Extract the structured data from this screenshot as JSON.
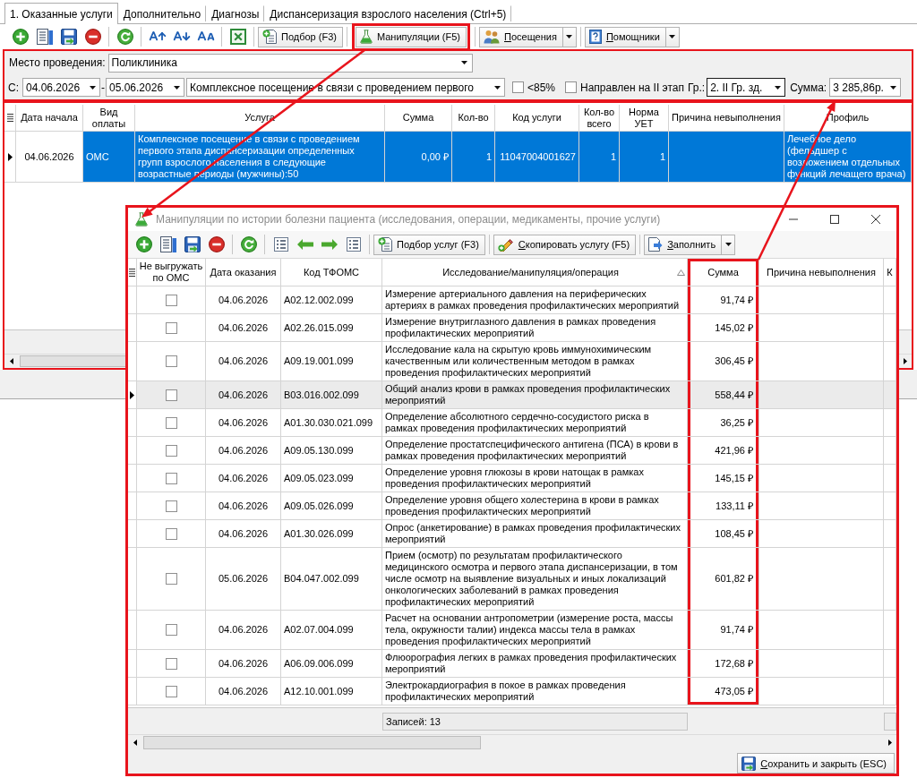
{
  "tabs": [
    {
      "label": "1. Оказанные услуги",
      "selected": true
    },
    {
      "label": "Дополнительно",
      "selected": false
    },
    {
      "label": "Диагнозы",
      "selected": false
    },
    {
      "label": "Диспансеризация взрослого населения (Ctrl+5)",
      "selected": false
    }
  ],
  "toolbar": {
    "buttons": [
      {
        "label": "Подбор (F3)",
        "kind": "button",
        "mnemonic": false,
        "highlighted": false
      },
      {
        "label": "Манипуляции (F5)",
        "kind": "button",
        "mnemonic": false,
        "highlighted": true
      },
      {
        "label": "Посещения",
        "kind": "split",
        "mnemonic": true,
        "highlighted": false
      },
      {
        "label": "Помощники",
        "kind": "split",
        "mnemonic": true,
        "highlighted": false
      }
    ]
  },
  "filters": {
    "highlighted": true,
    "place": {
      "label": "Место проведения:",
      "value": "Поликлиника"
    },
    "period": {
      "label": "С:",
      "from": "04.06.2026",
      "separator": "-",
      "to": "05.06.2026"
    },
    "visit_type": {
      "value": "Комплексное посещение в связи с проведением первого"
    },
    "checkboxes": [
      {
        "label": "<85%",
        "checked": false
      },
      {
        "label": "Направлен на II этап",
        "checked": false
      }
    ],
    "group": {
      "label": "Гр.:",
      "value": "2. II Гр. зд.",
      "focused": true
    },
    "sum": {
      "label": "Сумма:",
      "value": "3 285,86р."
    }
  },
  "services_table": {
    "highlighted": true,
    "columns": [
      "Дата начала",
      "Вид оплаты",
      "Услуга",
      "Сумма",
      "Кол-во",
      "Код услуги",
      "Кол-во всего",
      "Норма УЕТ",
      "Причина невыполнения",
      "Профиль"
    ],
    "rows": [
      {
        "selected": true,
        "cells": [
          {
            "text": "04.06.2026",
            "focused": true
          },
          {
            "text": "ОМС",
            "focused": false
          },
          {
            "text": "Комплексное посещение в связи с проведением первого этапа диспансеризации определенных групп взрослого населения в следующие возрастные периоды (мужчины):50",
            "focused": false
          },
          {
            "text": "0,00 ₽",
            "focused": false
          },
          {
            "text": "1",
            "focused": false
          },
          {
            "text": "11047004001627",
            "focused": false
          },
          {
            "text": "1",
            "focused": false
          },
          {
            "text": "1",
            "focused": false
          },
          {
            "focused": false
          },
          {
            "text": "Лечебное дело (фельдшер с возложением отдельных функций лечащего врача)",
            "focused": false
          }
        ]
      }
    ]
  },
  "dialog": {
    "title": "Манипуляции по истории болезни пациента (исследования, операции, медикаменты, прочие услуги)",
    "active": false,
    "highlighted": true,
    "toolbar": {
      "buttons": [
        {
          "label": "Подбор услуг (F3)",
          "kind": "button",
          "mnemonic": false
        },
        {
          "label": "Скопировать услугу (F5)",
          "kind": "button",
          "mnemonic": true
        },
        {
          "label": "Заполнить",
          "kind": "split",
          "mnemonic": true
        }
      ]
    },
    "table": {
      "columns": [
        {
          "label": "Не выгружать по ОМС",
          "sorted": false,
          "highlighted": false
        },
        {
          "label": "Дата оказания",
          "sorted": false,
          "highlighted": false
        },
        {
          "label": "Код ТФОМС",
          "sorted": false,
          "highlighted": false
        },
        {
          "label": "Исследование/манипуляция/операция",
          "sorted": true,
          "highlighted": false
        },
        {
          "label": "Сумма",
          "sorted": false,
          "highlighted": true
        },
        {
          "label": "Причина невыполнения",
          "sorted": false,
          "highlighted": false
        },
        {
          "label": "К",
          "sorted": false,
          "highlighted": false
        }
      ],
      "rows": [
        {
          "selected": false,
          "no_export": false,
          "date": "04.06.2026",
          "code": "A02.12.002.099",
          "name": "Измерение артериального давления на периферических артериях в рамках проведения профилактических мероприятий",
          "sum": "91,74 ₽"
        },
        {
          "selected": false,
          "no_export": false,
          "date": "04.06.2026",
          "code": "A02.26.015.099",
          "name": "Измерение внутриглазного давления в рамках проведения профилактических мероприятий",
          "sum": "145,02 ₽"
        },
        {
          "selected": false,
          "no_export": false,
          "date": "04.06.2026",
          "code": "A09.19.001.099",
          "name": "Исследование кала на скрытую кровь иммунохимическим качественным или количественным методом в рамках проведения профилактических мероприятий",
          "sum": "306,45 ₽"
        },
        {
          "selected": true,
          "no_export": false,
          "date": "04.06.2026",
          "code": "B03.016.002.099",
          "name": "Общий анализ крови в рамках проведения профилактических мероприятий",
          "sum": "558,44 ₽"
        },
        {
          "selected": false,
          "no_export": false,
          "date": "04.06.2026",
          "code": "A01.30.030.021.099",
          "name": "Определение абсолютного сердечно-сосудистого риска в рамках проведения профилактических мероприятий",
          "sum": "36,25 ₽"
        },
        {
          "selected": false,
          "no_export": false,
          "date": "04.06.2026",
          "code": "A09.05.130.099",
          "name": "Определение простатспецифического антигена (ПСА) в крови в рамках проведения профилактических мероприятий",
          "sum": "421,96 ₽"
        },
        {
          "selected": false,
          "no_export": false,
          "date": "04.06.2026",
          "code": "A09.05.023.099",
          "name": "Определение уровня глюкозы в крови натощак в рамках проведения профилактических мероприятий",
          "sum": "145,15 ₽"
        },
        {
          "selected": false,
          "no_export": false,
          "date": "04.06.2026",
          "code": "A09.05.026.099",
          "name": "Определение уровня общего холестерина в крови в рамках проведения профилактических мероприятий",
          "sum": "133,11 ₽"
        },
        {
          "selected": false,
          "no_export": false,
          "date": "04.06.2026",
          "code": "A01.30.026.099",
          "name": "Опрос (анкетирование) в рамках проведения профилактических мероприятий",
          "sum": "108,45 ₽"
        },
        {
          "selected": false,
          "no_export": false,
          "date": "05.06.2026",
          "code": "B04.047.002.099",
          "name": "Прием (осмотр) по результатам профилактического медицинского осмотра и первого этапа диспансеризации, в том числе осмотр на выявление визуальных и иных локализаций онкологических заболеваний в рамках проведения профилактических мероприятий",
          "sum": "601,82 ₽"
        },
        {
          "selected": false,
          "no_export": false,
          "date": "04.06.2026",
          "code": "A02.07.004.099",
          "name": "Расчет на основании антропометрии (измерение роста, массы тела, окружности талии) индекса массы тела в рамках проведения профилактических мероприятий",
          "sum": "91,74 ₽"
        },
        {
          "selected": false,
          "no_export": false,
          "date": "04.06.2026",
          "code": "A06.09.006.099",
          "name": "Флюорография легких в рамках проведения профилактических мероприятий",
          "sum": "172,68 ₽"
        },
        {
          "selected": false,
          "no_export": false,
          "date": "04.06.2026",
          "code": "A12.10.001.099",
          "name": "Электрокардиография в покое в рамках проведения профилактических мероприятий",
          "sum": "473,05 ₽"
        }
      ]
    },
    "footer": {
      "records": "Записей: 13"
    },
    "save_button": {
      "label": "Сохранить и закрыть (ESC)",
      "mnemonic": true
    }
  }
}
